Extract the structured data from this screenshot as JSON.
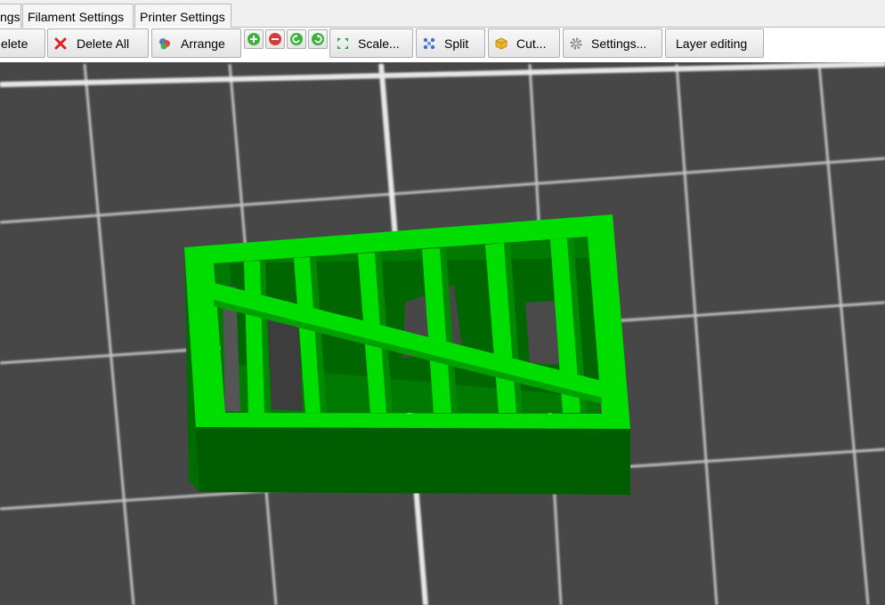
{
  "tabs": [
    {
      "label": "ngs"
    },
    {
      "label": "Filament Settings"
    },
    {
      "label": "Printer Settings"
    }
  ],
  "toolbar": {
    "delete_label": "elete",
    "delete_all_label": "Delete All",
    "arrange_label": "Arrange",
    "scale_label": "Scale...",
    "split_label": "Split",
    "cut_label": "Cut...",
    "settings_label": "Settings...",
    "layer_editing_label": "Layer editing",
    "icons": {
      "delete_all": "red-x-icon",
      "arrange": "arrange-icon",
      "increase": "plus-icon",
      "decrease": "minus-icon",
      "rotate_ccw": "rotate-left-icon",
      "rotate_cw": "rotate-right-icon",
      "scale": "scale-icon",
      "split": "split-icon",
      "cut": "cut-icon",
      "settings": "gear-icon"
    }
  },
  "viewport": {
    "background": "#474747",
    "grid_color": "#d8d8d8",
    "model_colors": {
      "top": "#00dd00",
      "side": "#005e00",
      "inner": "#007a00"
    }
  }
}
